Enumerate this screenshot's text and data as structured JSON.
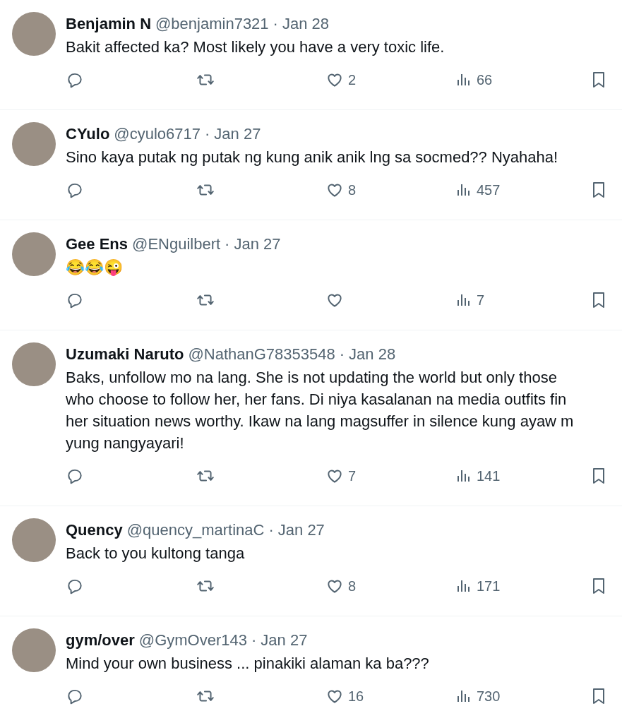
{
  "replies": [
    {
      "name": "Benjamin N",
      "handle": "@benjamin7321",
      "dot": "·",
      "date": "Jan 28",
      "lines": [
        "Bakit affected ka? Most likely you have a very toxic life."
      ],
      "likes": "2",
      "views": "66"
    },
    {
      "name": "CYulo",
      "handle": "@cyulo6717",
      "dot": "·",
      "date": "Jan 27",
      "lines": [
        "Sino kaya  putak ng putak ng kung anik anik lng sa socmed?? Nyahaha!"
      ],
      "likes": "8",
      "views": "457"
    },
    {
      "name": "Gee Ens",
      "handle": "@ENguilbert",
      "dot": "·",
      "date": "Jan 27",
      "lines": [
        "😂😂😜"
      ],
      "views": "7"
    },
    {
      "name": "Uzumaki Naruto",
      "handle": "@NathanG78353548",
      "dot": "·",
      "date": "Jan 28",
      "lines": [
        "Baks, unfollow mo na lang. She is not updating the world but only those",
        "who choose to follow her, her fans. Di niya kasalanan na media outfits fin",
        "her situation news worthy. Ikaw na lang magsuffer in silence kung ayaw m",
        "yung nangyayari!"
      ],
      "likes": "7",
      "views": "141"
    },
    {
      "name": "Quency",
      "handle": "@quency_martinaC",
      "dot": "·",
      "date": "Jan 27",
      "lines": [
        "Back to you kultong tanga"
      ],
      "likes": "8",
      "views": "171"
    },
    {
      "name": "gym/over",
      "handle": "@GymOver143",
      "dot": "·",
      "date": "Jan 27",
      "lines": [
        "Mind your own business ...  pinakiki  alaman  ka  ba???"
      ],
      "likes": "16",
      "views": "730"
    }
  ]
}
